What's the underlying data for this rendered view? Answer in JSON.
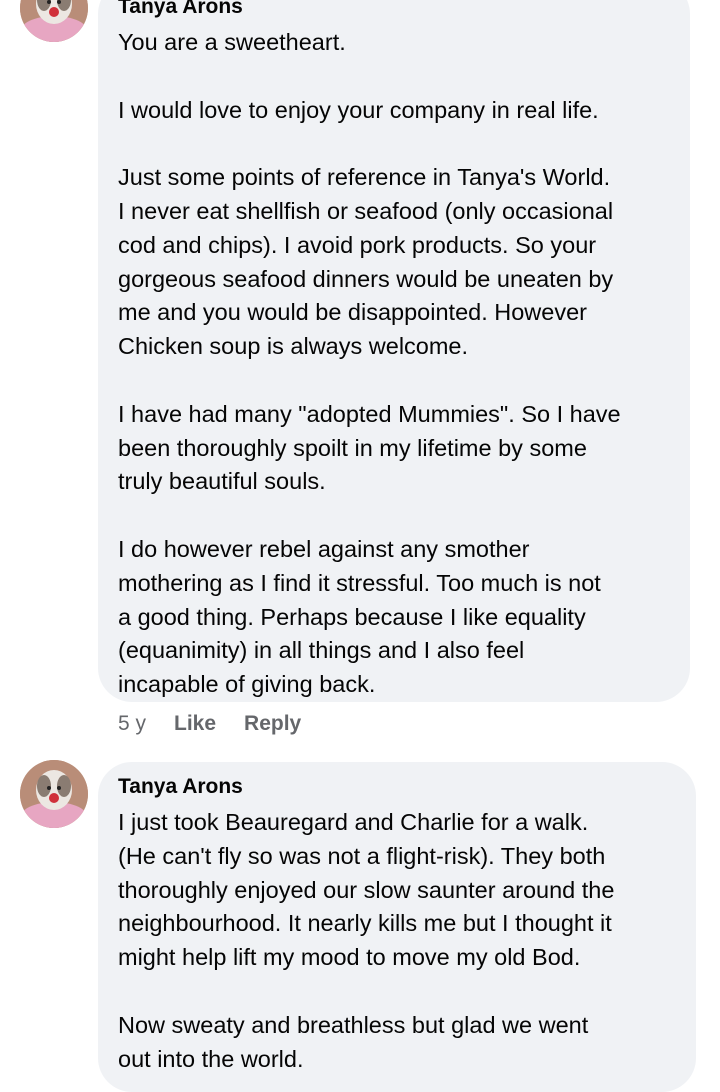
{
  "comments": [
    {
      "author": "Tanya Arons",
      "paragraphs": [
        "You are a sweetheart.",
        "I would love to enjoy your company in real life.",
        "Just some points of reference in Tanya's World.\nI never eat shellfish or seafood (only occasional\ncod and chips).  I avoid pork products.  So your\ngorgeous seafood dinners would be uneaten by\nme and you would be disappointed.  However\nChicken soup is always welcome.",
        "I have had many \"adopted Mummies\".  So I have\nbeen thoroughly spoilt in my lifetime by some\ntruly beautiful souls.",
        "I do however rebel against any smother\nmothering as I find it stressful.  Too much is not\na good thing. Perhaps because I like equality\n(equanimity) in all things and I also feel\nincapable of giving back."
      ],
      "time": "5 y",
      "like_label": "Like",
      "reply_label": "Reply"
    },
    {
      "author": "Tanya Arons",
      "paragraphs": [
        "I just took Beauregard  and Charlie for a walk.\n(He can't fly so was not a flight-risk).  They both\nthoroughly enjoyed our slow saunter around the\nneighbourhood.  It nearly kills me but I thought it\nmight help lift my mood to move my old Bod.",
        "Now sweaty and breathless but glad we went\nout into the world."
      ]
    }
  ],
  "colors": {
    "bubble": "#f0f2f5",
    "text": "#050505",
    "meta": "#65676b"
  }
}
